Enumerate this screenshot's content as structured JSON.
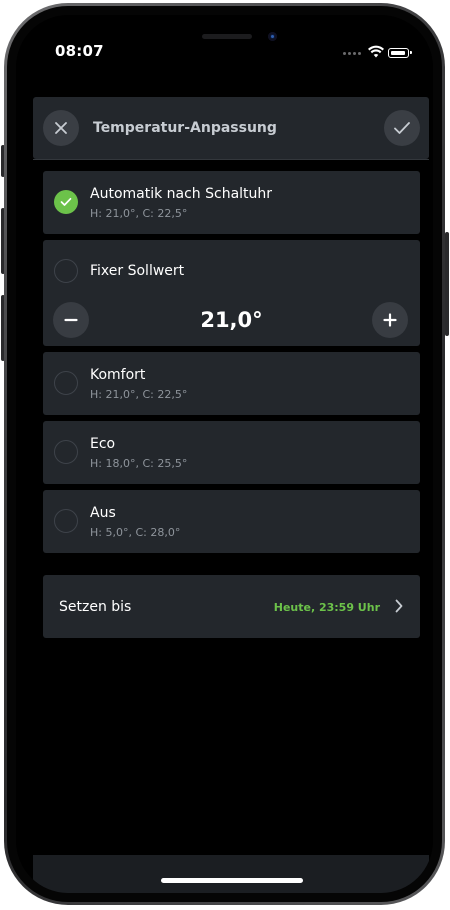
{
  "status_bar": {
    "time": "08:07"
  },
  "header": {
    "title": "Temperatur-Anpassung",
    "close_icon": "close-icon",
    "confirm_icon": "checkmark-icon"
  },
  "options": [
    {
      "title": "Automatik nach Schaltuhr",
      "subtitle": "H: 21,0°, C: 22,5°",
      "selected": true
    },
    {
      "title": "Fixer Sollwert",
      "subtitle": "",
      "selected": false
    },
    {
      "title": "Komfort",
      "subtitle": "H: 21,0°, C: 22,5°",
      "selected": false
    },
    {
      "title": "Eco",
      "subtitle": "H: 18,0°, C: 25,5°",
      "selected": false
    },
    {
      "title": "Aus",
      "subtitle": "H: 5,0°, C: 28,0°",
      "selected": false
    }
  ],
  "fixed_setpoint": {
    "value": "21,0°",
    "decrement_icon": "minus-icon",
    "increment_icon": "plus-icon"
  },
  "set_until": {
    "label": "Setzen bis",
    "value": "Heute, 23:59 Uhr",
    "icon": "chevron-right-icon"
  },
  "colors": {
    "accent_green": "#6cc24a",
    "card_background": "#23272c",
    "screen_background": "#000000"
  }
}
